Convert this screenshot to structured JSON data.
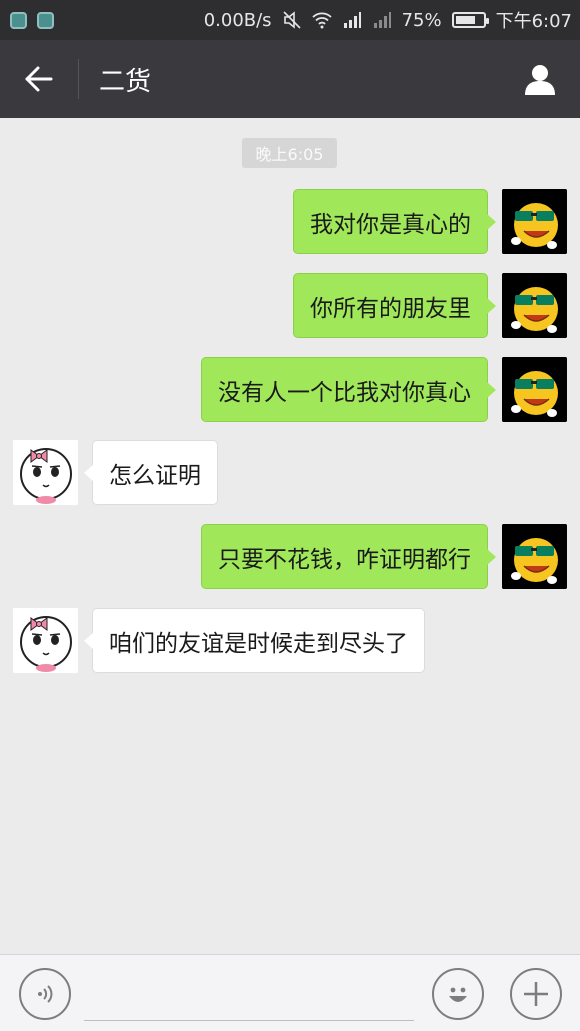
{
  "status_bar": {
    "network_speed": "0.00B/s",
    "battery": "75%",
    "battery_level": 0.75,
    "time": "下午6:07",
    "icons": [
      "app-icon",
      "app-icon",
      "mute-icon",
      "wifi-icon",
      "signal-icon",
      "signal-icon",
      "battery-icon"
    ]
  },
  "header": {
    "title": "二货",
    "back_icon": "back-arrow-icon",
    "profile_icon": "person-icon"
  },
  "chat": {
    "timestamp": "晚上6:05",
    "messages": [
      {
        "sender": "me",
        "text": "我对你是真心的"
      },
      {
        "sender": "me",
        "text": "你所有的朋友里"
      },
      {
        "sender": "me",
        "text": "没有人一个比我对你真心"
      },
      {
        "sender": "other",
        "text": "怎么证明"
      },
      {
        "sender": "me",
        "text": "只要不花钱，咋证明都行"
      },
      {
        "sender": "other",
        "text": "咱们的友谊是时候走到尽头了"
      }
    ]
  },
  "input_bar": {
    "placeholder": "",
    "icons": [
      "voice-icon",
      "emoji-icon",
      "plus-icon"
    ]
  },
  "colors": {
    "status_bar_bg": "#2e2e30",
    "header_bg": "#3a393e",
    "chat_bg": "#ebebeb",
    "my_bubble": "#a0e75a",
    "their_bubble": "#ffffff"
  }
}
